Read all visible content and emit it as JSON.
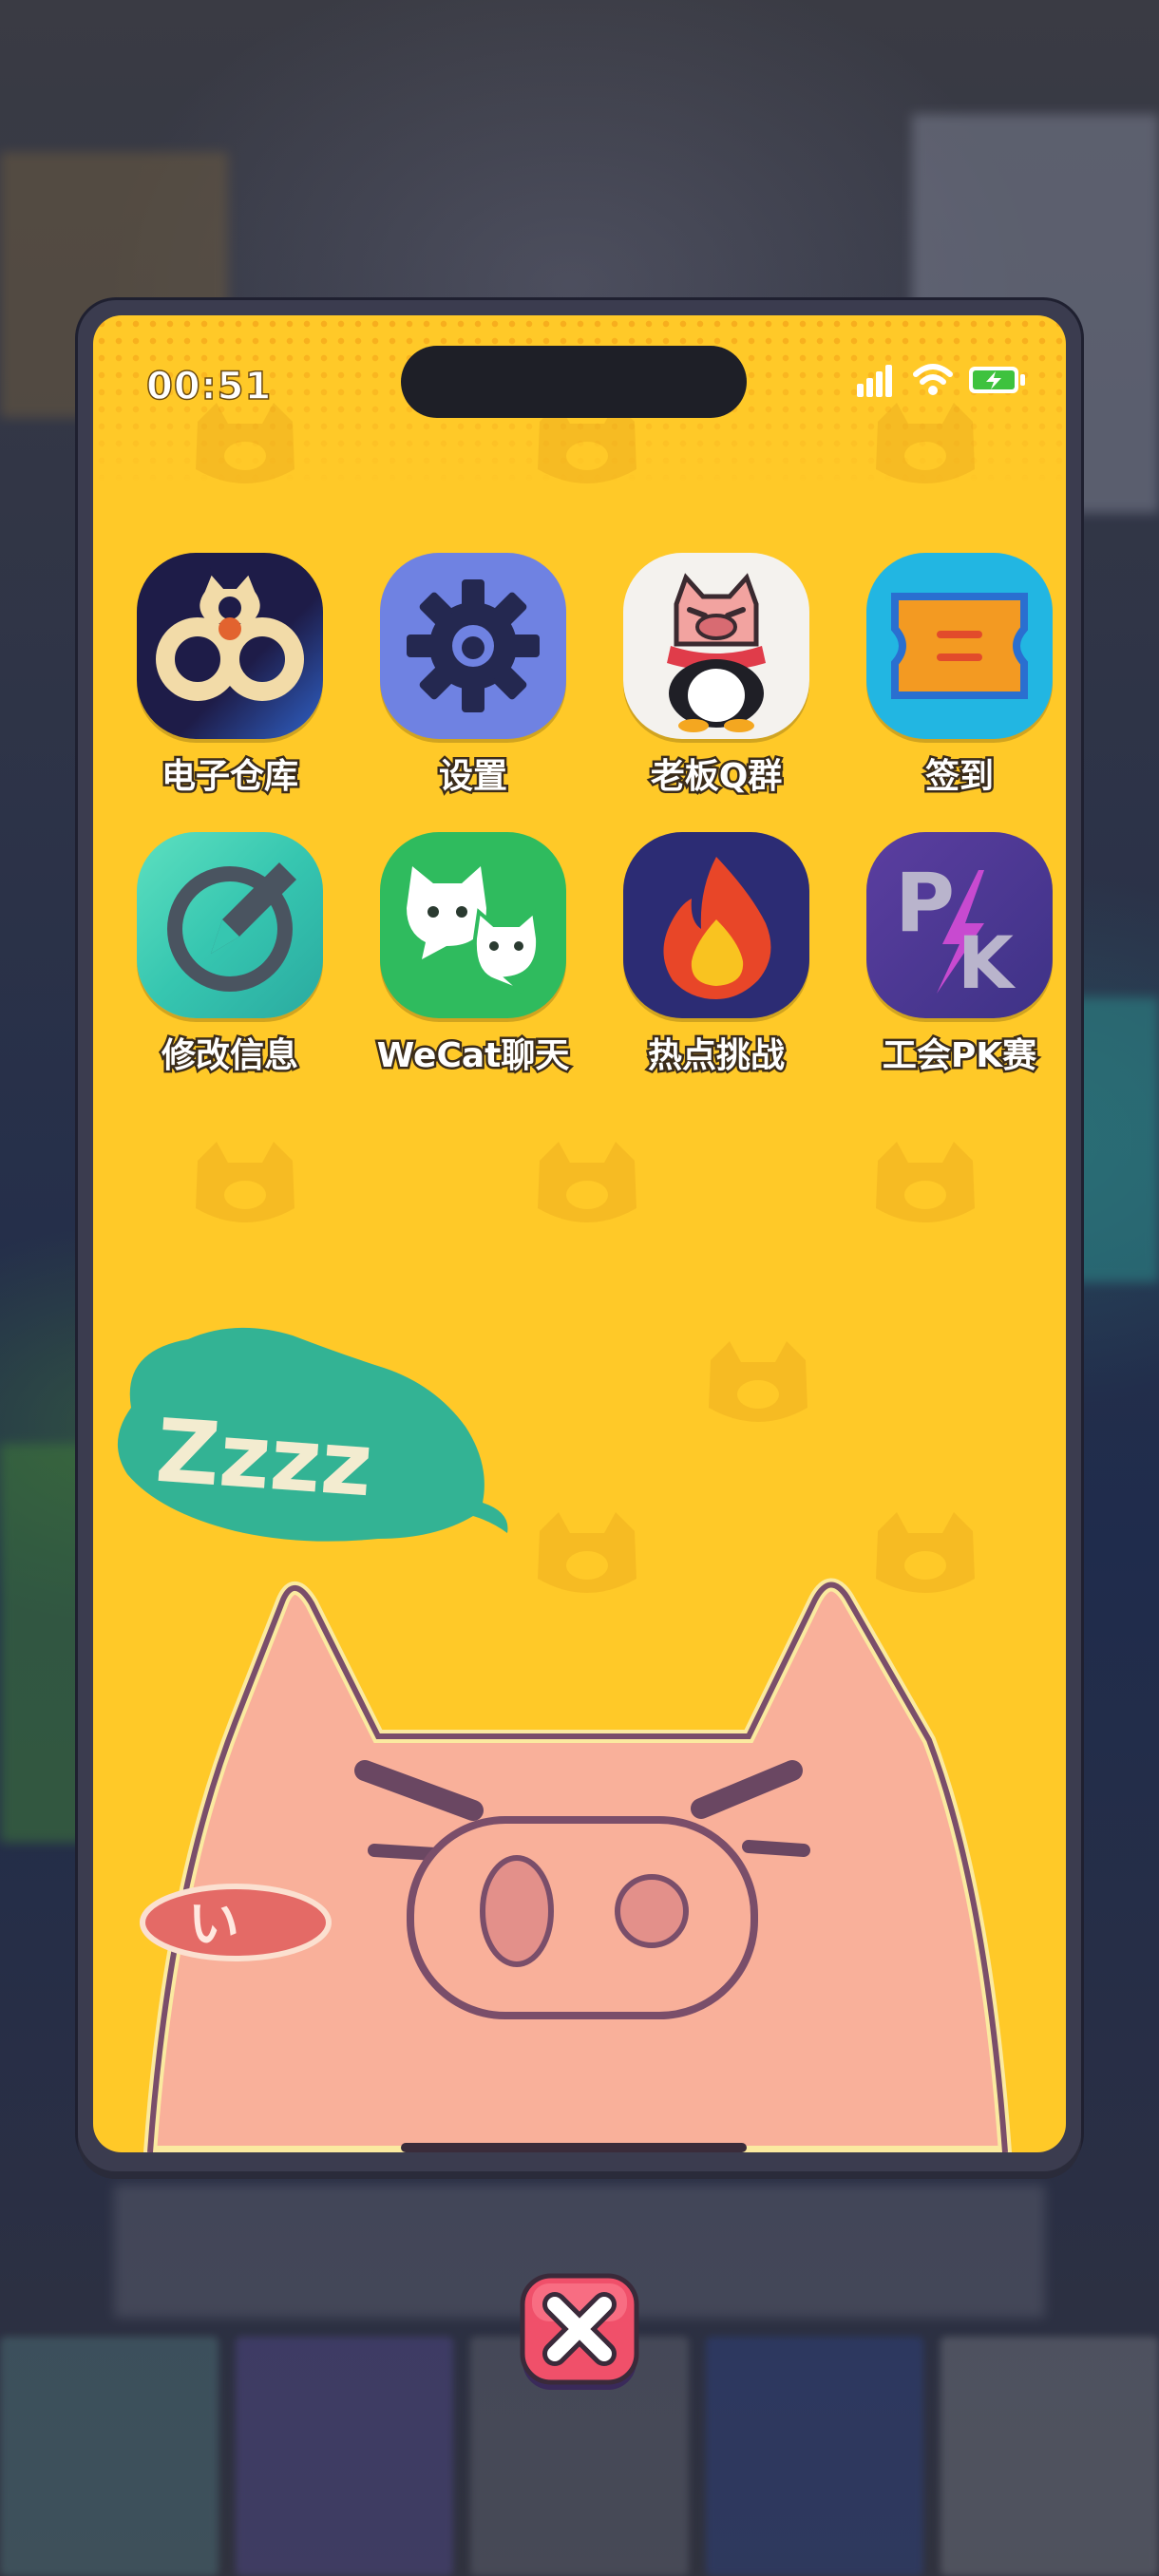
{
  "status_bar": {
    "time": "00:51",
    "icons": [
      "signal-icon",
      "wifi-icon",
      "battery-charging-icon"
    ]
  },
  "apps": [
    {
      "label": "电子仓库",
      "icon": "cat-link-icon"
    },
    {
      "label": "设置",
      "icon": "gear-icon"
    },
    {
      "label": "老板Q群",
      "icon": "pig-penguin-icon"
    },
    {
      "label": "签到",
      "icon": "ticket-icon"
    },
    {
      "label": "修改信息",
      "icon": "pencil-icon"
    },
    {
      "label": "WeCat聊天",
      "icon": "chat-cats-icon"
    },
    {
      "label": "热点挑战",
      "icon": "flame-icon"
    },
    {
      "label": "工会PK赛",
      "icon": "pk-icon"
    }
  ],
  "wallpaper": {
    "bubble_text": "Zzzz",
    "blush_text": "い"
  },
  "close_button": {
    "icon": "close-icon"
  },
  "colors": {
    "screen_bg": "#ffc928",
    "pig_skin": "#f9b09a",
    "bubble": "#33b394",
    "phone_frame": "#3b3c4f"
  }
}
